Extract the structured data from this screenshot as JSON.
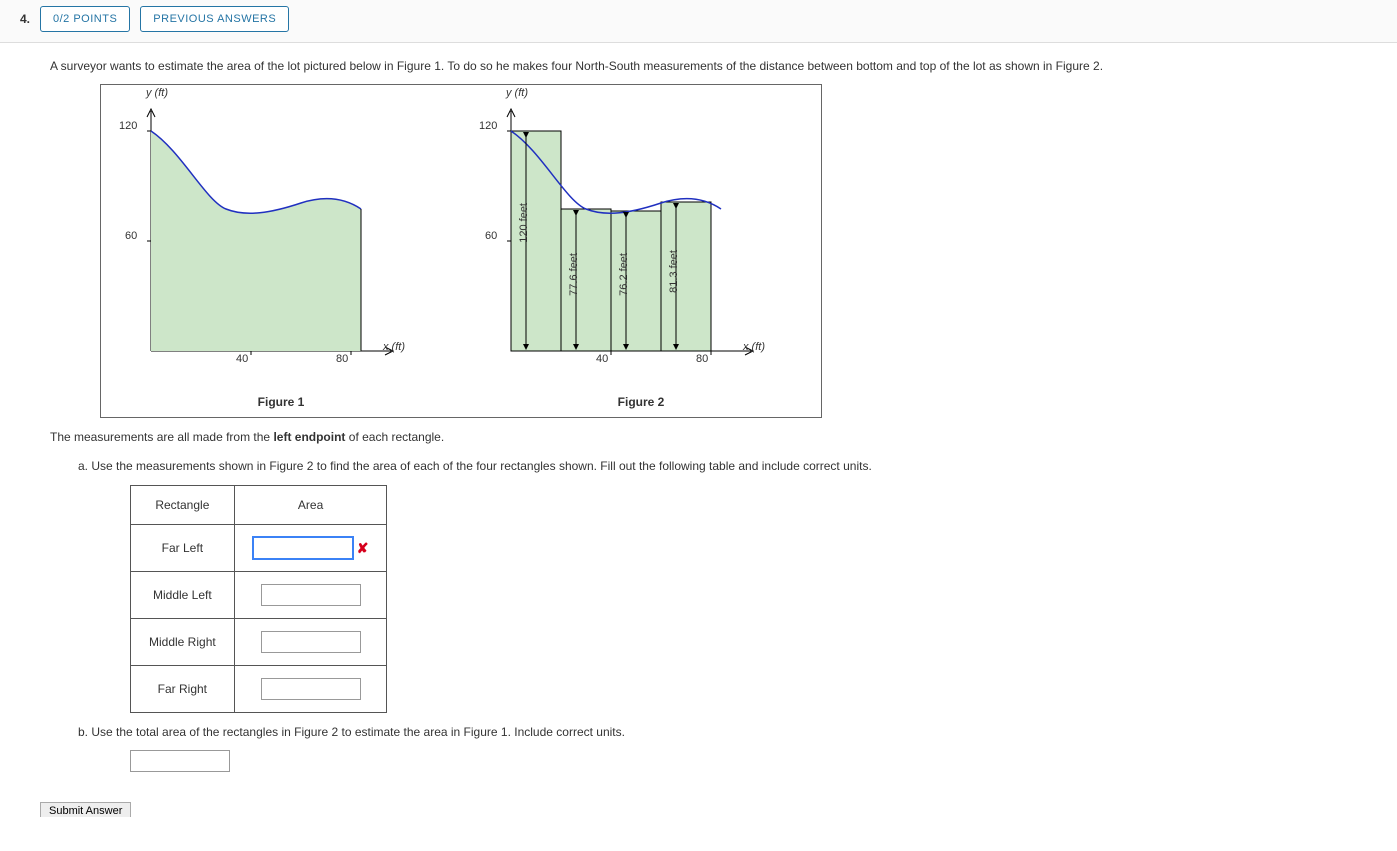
{
  "question_number": "4.",
  "points_pill": "0/2 POINTS",
  "prev_answers_pill": "PREVIOUS ANSWERS",
  "prompt": "A surveyor wants to estimate the area of the lot pictured below in Figure 1. To do so he makes four North-South measurements of the distance between bottom and top of the lot as shown in Figure 2.",
  "note_prefix": "The measurements are all made from the ",
  "note_bold": "left endpoint",
  "note_suffix": " of each rectangle.",
  "part_a": "a. Use the measurements shown in Figure 2 to find the area of each of the four rectangles shown. Fill out the following table and include correct units.",
  "part_b": "b. Use the total area of the rectangles in Figure 2 to estimate the area in Figure 1. Include correct units.",
  "table": {
    "headers": {
      "col1": "Rectangle",
      "col2": "Area"
    },
    "rows": [
      {
        "label": "Far Left"
      },
      {
        "label": "Middle Left"
      },
      {
        "label": "Middle Right"
      },
      {
        "label": "Far Right"
      }
    ]
  },
  "submit_label": "Submit Answer",
  "fig1": {
    "caption": "Figure 1",
    "y_label": "y (ft)",
    "x_label": "x (ft)",
    "y_ticks": [
      "60",
      "120"
    ],
    "x_ticks": [
      "40",
      "80"
    ]
  },
  "fig2": {
    "caption": "Figure 2",
    "y_label": "y (ft)",
    "x_label": "x (ft)",
    "y_ticks": [
      "60",
      "120"
    ],
    "x_ticks": [
      "40",
      "80"
    ],
    "bar_labels": [
      "120 feet",
      "77.6 feet",
      "76.2 feet",
      "81.3 feet"
    ]
  },
  "chart_data": {
    "type": "area",
    "title": "",
    "xlabel": "x (ft)",
    "ylabel": "y (ft)",
    "xlim": [
      0,
      80
    ],
    "ylim": [
      0,
      120
    ],
    "curve_points": [
      {
        "x": 0,
        "y": 120
      },
      {
        "x": 20,
        "y": 77.6
      },
      {
        "x": 40,
        "y": 76.2
      },
      {
        "x": 60,
        "y": 81.3
      },
      {
        "x": 80,
        "y": 78
      }
    ],
    "rectangles_left_endpoint": {
      "width": 20,
      "heights": [
        120,
        77.6,
        76.2,
        81.3
      ],
      "x_starts": [
        0,
        20,
        40,
        60
      ]
    }
  }
}
